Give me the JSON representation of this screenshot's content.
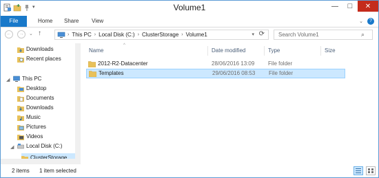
{
  "window": {
    "title": "Volume1"
  },
  "qat": {
    "icons": [
      "properties-icon",
      "new-folder-icon",
      "pin-icon",
      "qat-dropdown-icon"
    ]
  },
  "controls": {
    "minimize": "—",
    "maximize": "□",
    "close": "✕"
  },
  "ribbon": {
    "tabs": [
      {
        "label": "File"
      },
      {
        "label": "Home"
      },
      {
        "label": "Share"
      },
      {
        "label": "View"
      }
    ],
    "help": "?",
    "expand": "⌄"
  },
  "nav": {
    "back": "←",
    "forward": "→",
    "history": "⌄",
    "up": "↑",
    "refresh": "⟳"
  },
  "address": {
    "segments": [
      "This PC",
      "Local Disk (C:)",
      "ClusterStorage",
      "Volume1"
    ]
  },
  "search": {
    "placeholder": "Search Volume1"
  },
  "navpane": {
    "items": [
      {
        "label": "Downloads"
      },
      {
        "label": "Recent places"
      },
      {
        "label": "This PC"
      },
      {
        "label": "Desktop"
      },
      {
        "label": "Documents"
      },
      {
        "label": "Downloads"
      },
      {
        "label": "Music"
      },
      {
        "label": "Pictures"
      },
      {
        "label": "Videos"
      },
      {
        "label": "Local Disk (C:)"
      },
      {
        "label": "ClusterStorage"
      }
    ]
  },
  "columns": [
    "Name",
    "Date modified",
    "Type",
    "Size"
  ],
  "files": [
    {
      "name": "2012-R2-Datacenter",
      "date": "28/06/2016 13:09",
      "type": "File folder",
      "size": ""
    },
    {
      "name": "Templates",
      "date": "29/06/2016 08:53",
      "type": "File folder",
      "size": ""
    }
  ],
  "status": {
    "count": "2 items",
    "selected": "1 item selected"
  },
  "colors": {
    "accent": "#1979ca",
    "selection": "#cce8ff",
    "folder": "#e8c15a",
    "close": "#c42b1c"
  }
}
